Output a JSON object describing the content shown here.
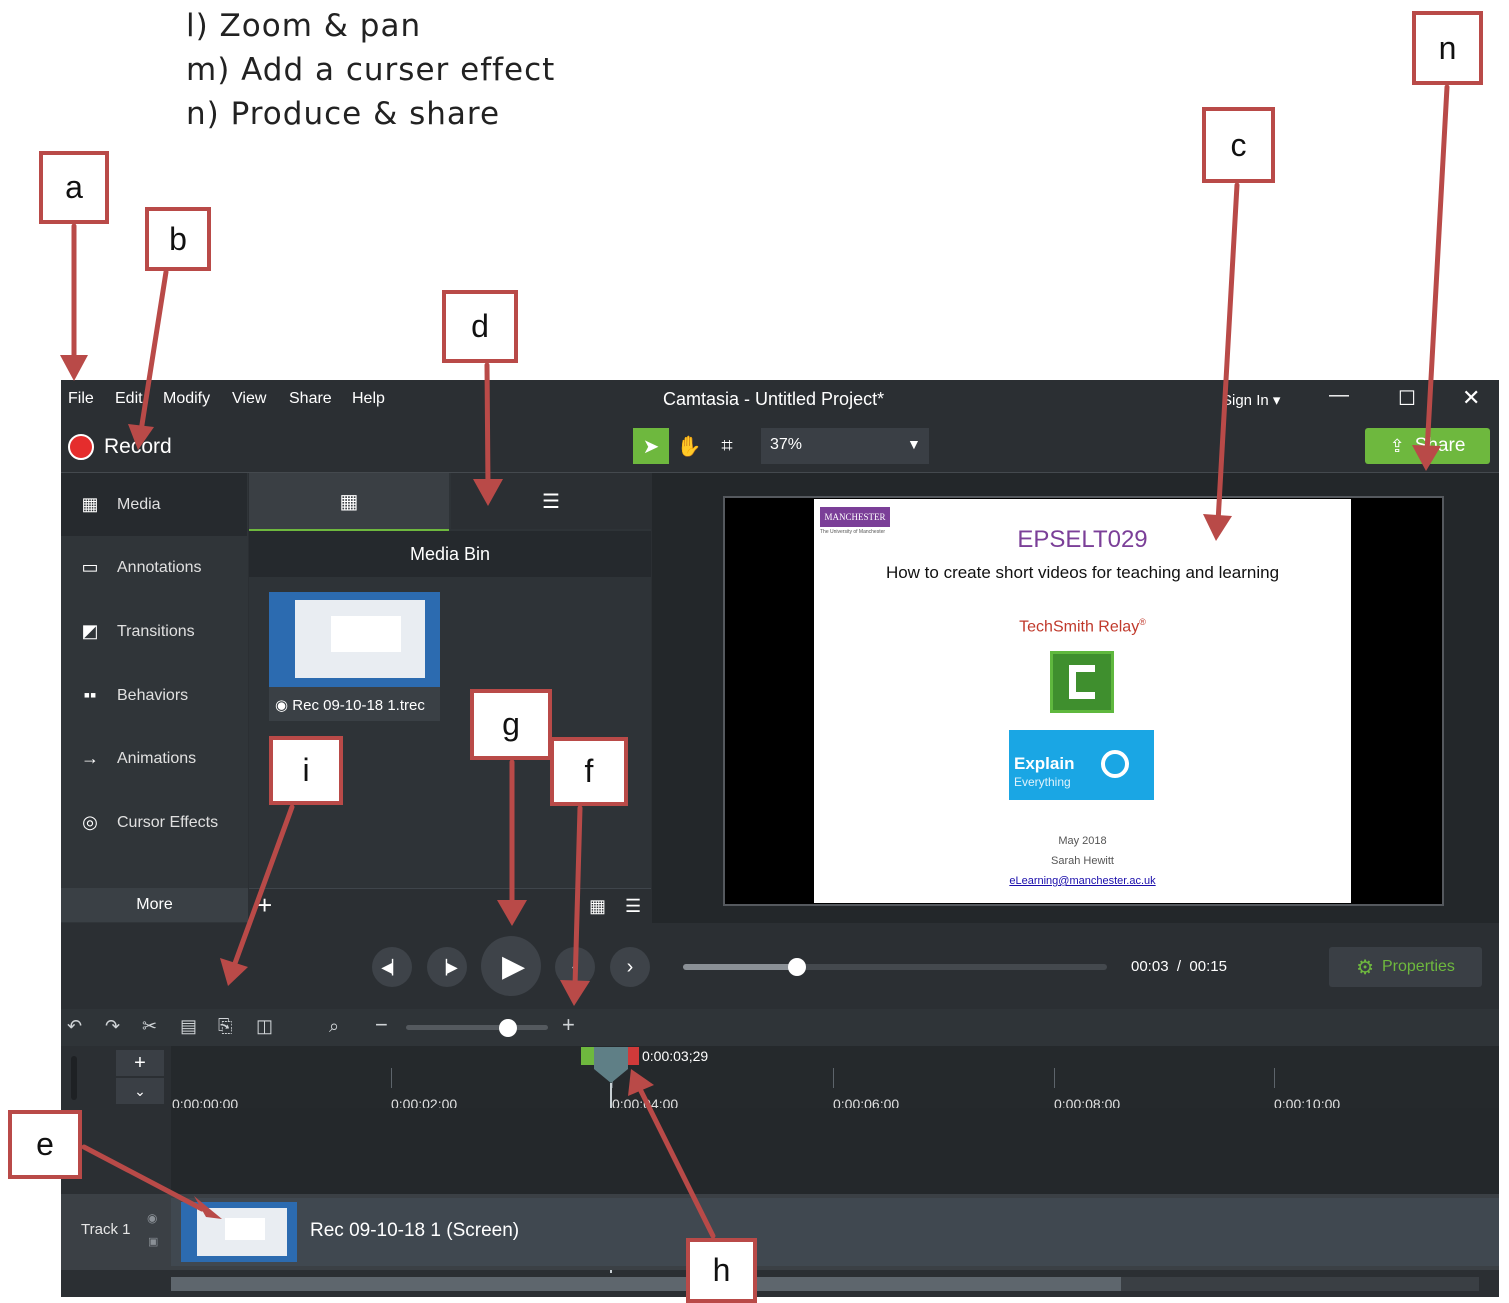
{
  "intro_list": [
    "l)  Zoom & pan",
    "m) Add a curser effect",
    "n)  Produce & share"
  ],
  "labels": {
    "a": "a",
    "b": "b",
    "c": "c",
    "d": "d",
    "e": "e",
    "f": "f",
    "g": "g",
    "h": "h",
    "i": "i",
    "n": "n"
  },
  "menu": [
    "File",
    "Edit",
    "Modify",
    "View",
    "Share",
    "Help"
  ],
  "window_title": "Camtasia - Untitled Project*",
  "sign_in": "Sign In",
  "record_label": "Record",
  "zoom_value": "37%",
  "share_label": "Share",
  "sidebar": {
    "items": [
      {
        "label": "Media",
        "icon": "film-icon"
      },
      {
        "label": "Annotations",
        "icon": "annotation-icon"
      },
      {
        "label": "Transitions",
        "icon": "transition-icon"
      },
      {
        "label": "Behaviors",
        "icon": "behaviors-icon"
      },
      {
        "label": "Animations",
        "icon": "animation-icon"
      },
      {
        "label": "Cursor Effects",
        "icon": "cursor-effects-icon"
      }
    ],
    "more_label": "More"
  },
  "media_bin": {
    "title": "Media Bin",
    "item_label": "Rec 09-10-18 1.trec"
  },
  "canvas_slide": {
    "logo_text": "MANCHESTER 1824",
    "logo_sub": "The University of Manchester",
    "title": "EPSELT029",
    "subtitle": "How to create short videos for teaching and learning",
    "relay": "TechSmith Relay",
    "relay_mark": "®",
    "explain_line1": "Explain",
    "explain_line2": "Everything",
    "date": "May 2018",
    "author": "Sarah Hewitt",
    "email": "eLearning@manchester.ac.uk"
  },
  "playback": {
    "current": "00:03",
    "separator": "/",
    "total": "00:15",
    "progress": 0.27
  },
  "properties_label": "Properties",
  "timeline": {
    "playhead_time": "0:00:03;29",
    "ruler": [
      "0:00:00;00",
      "0:00:02;00",
      "0:00:04;00",
      "0:00:06;00",
      "0:00:08;00",
      "0:00:10;00"
    ],
    "track_label": "Track 1",
    "clip_label": "Rec 09-10-18 1 (Screen)",
    "zoom_level": 0.72
  },
  "colors": {
    "accent": "#6eb83e",
    "arrow": "#b94a48",
    "panel": "#2b2f33",
    "purple": "#7b3f98"
  }
}
